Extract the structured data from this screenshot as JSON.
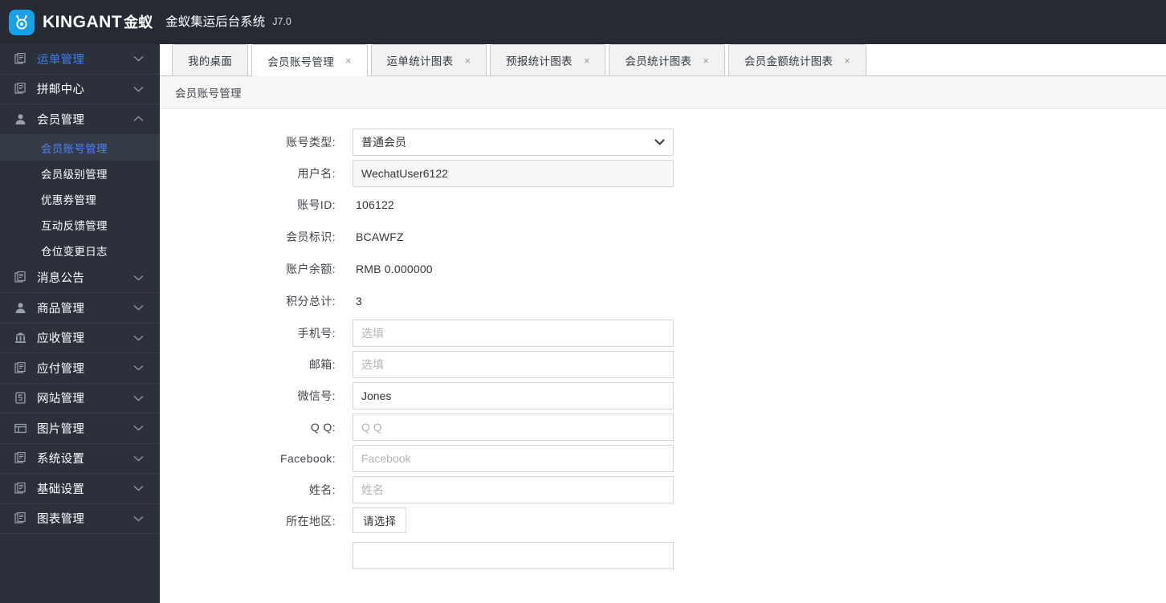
{
  "header": {
    "logo_icon": "kingant-ant-logo-icon",
    "brand_latin": "KINGANT",
    "brand_cn": "金蚁",
    "system_title": "金蚁集运后台系统",
    "version": "J7.0"
  },
  "sidebar": {
    "items": [
      {
        "label": "运单管理",
        "icon": "document-list-icon",
        "caret": "chevron-down-icon",
        "active": true,
        "expanded": false
      },
      {
        "label": "拼邮中心",
        "icon": "document-list-icon",
        "caret": "chevron-down-icon",
        "active": false,
        "expanded": false
      },
      {
        "label": "会员管理",
        "icon": "user-icon",
        "caret": "chevron-up-icon",
        "active": false,
        "expanded": true
      },
      {
        "label": "消息公告",
        "icon": "document-list-icon",
        "caret": "chevron-down-icon",
        "active": false,
        "expanded": false
      },
      {
        "label": "商品管理",
        "icon": "user-icon",
        "caret": "chevron-down-icon",
        "active": false,
        "expanded": false
      },
      {
        "label": "应收管理",
        "icon": "bank-icon",
        "caret": "chevron-down-icon",
        "active": false,
        "expanded": false
      },
      {
        "label": "应付管理",
        "icon": "document-list-icon",
        "caret": "chevron-down-icon",
        "active": false,
        "expanded": false
      },
      {
        "label": "网站管理",
        "icon": "browser-icon",
        "caret": "chevron-down-icon",
        "active": false,
        "expanded": false
      },
      {
        "label": "图片管理",
        "icon": "image-frame-icon",
        "caret": "chevron-down-icon",
        "active": false,
        "expanded": false
      },
      {
        "label": "系统设置",
        "icon": "document-list-icon",
        "caret": "chevron-down-icon",
        "active": false,
        "expanded": false
      },
      {
        "label": "基础设置",
        "icon": "document-list-icon",
        "caret": "chevron-down-icon",
        "active": false,
        "expanded": false
      },
      {
        "label": "图表管理",
        "icon": "document-list-icon",
        "caret": "chevron-down-icon",
        "active": false,
        "expanded": false
      }
    ],
    "submenu": [
      {
        "label": "会员账号管理",
        "selected": true
      },
      {
        "label": "会员级别管理",
        "selected": false
      },
      {
        "label": "优惠券管理",
        "selected": false
      },
      {
        "label": "互动反馈管理",
        "selected": false
      },
      {
        "label": "仓位变更日志",
        "selected": false
      }
    ],
    "accent_active": "#3d7ef0",
    "accent_selected": "#4b84f5",
    "bg": "#2b303b"
  },
  "tabs": [
    {
      "label": "我的桌面",
      "active": false,
      "closable": false,
      "close_glyph": ""
    },
    {
      "label": "会员账号管理",
      "active": true,
      "closable": true,
      "close_glyph": "×"
    },
    {
      "label": "运单统计图表",
      "active": false,
      "closable": true,
      "close_glyph": "×"
    },
    {
      "label": "预报统计图表",
      "active": false,
      "closable": true,
      "close_glyph": "×"
    },
    {
      "label": "会员统计图表",
      "active": false,
      "closable": true,
      "close_glyph": "×"
    },
    {
      "label": "会员金额统计图表",
      "active": false,
      "closable": true,
      "close_glyph": "×"
    }
  ],
  "breadcrumb": {
    "text": "会员账号管理"
  },
  "form": {
    "account_type": {
      "label": "账号类型:",
      "value": "普通会员",
      "options": [
        "普通会员"
      ],
      "caret_icon": "chevron-down-icon"
    },
    "username": {
      "label": "用户名:",
      "value": "WechatUser6122",
      "placeholder": "",
      "readonly": true
    },
    "account_id": {
      "label": "账号ID:",
      "value": "106122"
    },
    "member_code": {
      "label": "会员标识:",
      "value": "BCAWFZ"
    },
    "balance": {
      "label": "账户余额:",
      "value": "RMB 0.000000"
    },
    "points": {
      "label": "积分总计:",
      "value": "3"
    },
    "phone": {
      "label": "手机号:",
      "value": "",
      "placeholder": "选填"
    },
    "email": {
      "label": "邮箱:",
      "value": "",
      "placeholder": "选填"
    },
    "wechat": {
      "label": "微信号:",
      "value": "Jones",
      "placeholder": ""
    },
    "qq": {
      "label": "Q Q:",
      "value": "",
      "placeholder": "Q Q"
    },
    "facebook": {
      "label": "Facebook:",
      "value": "",
      "placeholder": "Facebook"
    },
    "realname": {
      "label": "姓名:",
      "value": "",
      "placeholder": "姓名"
    },
    "region": {
      "label": "所在地区:",
      "button_label": "请选择"
    },
    "tail_field": {
      "label": "",
      "value": "",
      "placeholder": ""
    }
  }
}
